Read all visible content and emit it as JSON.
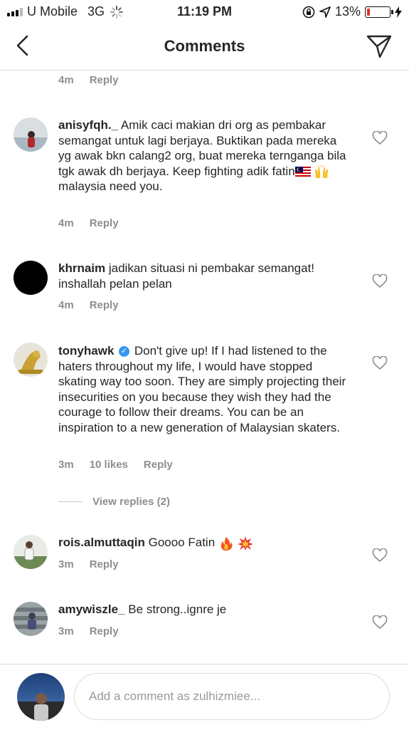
{
  "status_bar": {
    "carrier": "U Mobile",
    "network": "3G",
    "time": "11:19 PM",
    "battery": "13%",
    "battery_level": 0.13
  },
  "header": {
    "title": "Comments"
  },
  "top_meta": {
    "time": "4m",
    "reply": "Reply"
  },
  "comments": [
    {
      "username": "anisyfqh._",
      "text_before_flag": "Amik caci makian dri org as pembakar semangat untuk lagi berjaya. Buktikan pada mereka yg awak bkn calang2 org, buat mereka ternganga bila tgk awak dh berjaya. Keep fighting adik fatin",
      "text_after_emoji": "malaysia need you.",
      "time": "4m",
      "reply": "Reply"
    },
    {
      "username": "khrnaim",
      "text": "jadikan situasi ni pembakar semangat! inshallah pelan pelan",
      "time": "4m",
      "reply": "Reply"
    },
    {
      "username": "tonyhawk",
      "verified": true,
      "text": "Don't give up! If I had listened to the haters throughout my life, I would have stopped skating way too soon. They are simply projecting their insecurities on you because they wish they had the courage to follow their dreams. You can be an inspiration to a new generation of Malaysian skaters.",
      "time": "3m",
      "likes": "10 likes",
      "reply": "Reply",
      "view_replies": "View replies (2)"
    },
    {
      "username": "rois.almuttaqin",
      "text": "Goooo Fatin",
      "time": "3m",
      "reply": "Reply"
    },
    {
      "username": "amywiszle_",
      "text": "Be strong..ignre je",
      "time": "3m",
      "reply": "Reply"
    }
  ],
  "composer": {
    "placeholder": "Add a comment as zulhizmiee..."
  },
  "colors": {
    "accent_verified": "#3897f0",
    "battery_low": "#e0302c",
    "meta_gray": "#8e8e8e"
  }
}
